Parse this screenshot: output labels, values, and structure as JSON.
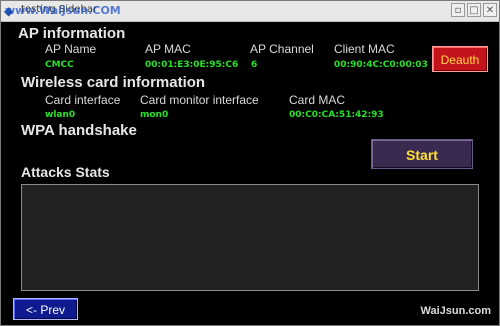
{
  "window": {
    "title": "testing Sidebar",
    "watermark": "www.WaiJsun.COM"
  },
  "ap_info": {
    "heading": "AP information",
    "columns": [
      "AP Name",
      "AP MAC",
      "AP Channel",
      "Client MAC"
    ],
    "values": [
      "CMCC",
      "00:01:E3:0E:95:C6",
      "6",
      "00:90:4C:C0:00:03"
    ],
    "deauth_label": "Deauth"
  },
  "wireless_card": {
    "heading": "Wireless card information",
    "columns": [
      "Card interface",
      "Card monitor interface",
      "Card MAC"
    ],
    "values": [
      "wlan0",
      "mon0",
      "00:C0:CA:51:42:93"
    ]
  },
  "wpa": {
    "heading": "WPA handshake",
    "start_label": "Start"
  },
  "attacks": {
    "heading": "Attacks Stats"
  },
  "footer": {
    "prev_label": "<- Prev",
    "corner_watermark": "WaiJsun.com"
  },
  "colors": {
    "background": "#000000",
    "value_green": "#28e028",
    "deauth_red": "#c2141a",
    "start_purple": "#3a2a50",
    "prev_blue": "#0e1a8e"
  }
}
